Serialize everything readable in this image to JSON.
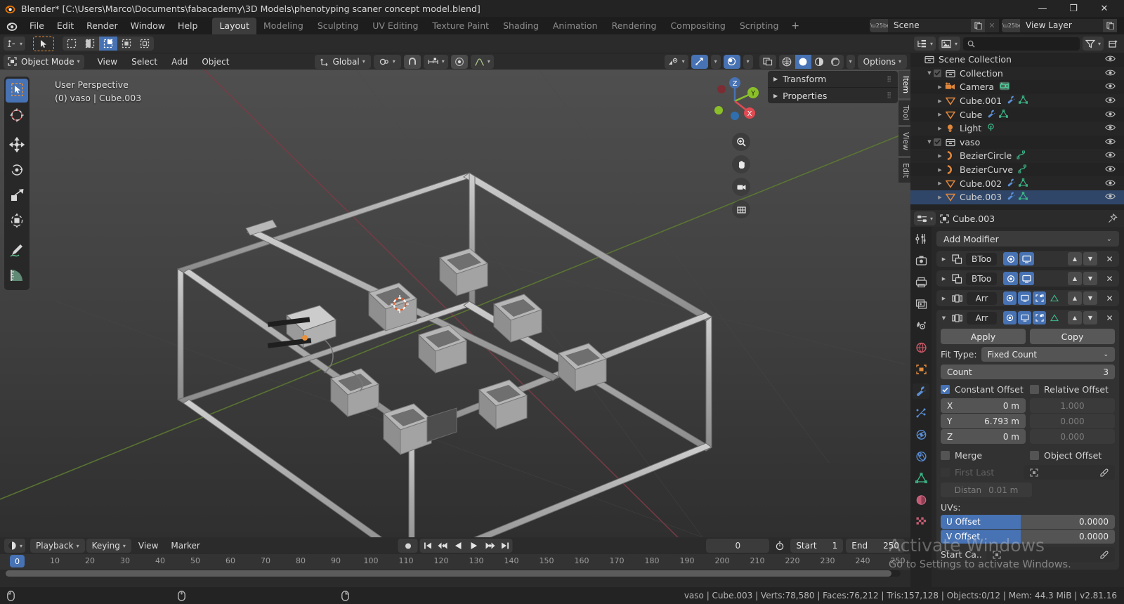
{
  "window": {
    "title": "Blender* [C:\\Users\\Marco\\Documents\\fabacademy\\3D Models\\phenotyping scaner concept model.blend]",
    "minimize": "—",
    "maximize": "❐",
    "close": "✕"
  },
  "menubar": {
    "items": [
      "File",
      "Edit",
      "Render",
      "Window",
      "Help"
    ],
    "workspaces": [
      {
        "label": "Layout",
        "active": true
      },
      {
        "label": "Modeling",
        "active": false
      },
      {
        "label": "Sculpting",
        "active": false
      },
      {
        "label": "UV Editing",
        "active": false
      },
      {
        "label": "Texture Paint",
        "active": false
      },
      {
        "label": "Shading",
        "active": false
      },
      {
        "label": "Animation",
        "active": false
      },
      {
        "label": "Rendering",
        "active": false
      },
      {
        "label": "Compositing",
        "active": false
      },
      {
        "label": "Scripting",
        "active": false
      }
    ],
    "add_workspace": "+",
    "scene": {
      "name": "Scene",
      "new_icon": "copy-icon",
      "delete_icon": "x-icon"
    },
    "view_layer": {
      "name": "View Layer",
      "new_icon": "copy-icon"
    }
  },
  "viewport": {
    "editor_type_icon": "editor-type-icon",
    "select_tools": [
      "tweak",
      "select-box",
      "select-circle",
      "select-lasso"
    ],
    "mode": "Object Mode",
    "menus": [
      "View",
      "Select",
      "Add",
      "Object"
    ],
    "transform_orientation": "Global",
    "snap_magnet": "magnet-icon",
    "proportional_edit": "proportional-icon",
    "overlay_text_line1": "User Perspective",
    "overlay_text_line2": "(0) vaso | Cube.003",
    "options_label": "Options",
    "shading_modes": [
      "wireframe",
      "solid",
      "material-preview",
      "rendered"
    ],
    "active_shading": "solid",
    "gizmo_axes": [
      {
        "label": "Z",
        "color": "#4772b3"
      },
      {
        "label": "Y",
        "color": "#8bbf2a"
      },
      {
        "label": "X",
        "color": "#e04a52"
      }
    ],
    "nav_buttons": [
      "zoom-icon",
      "pan-hand-icon",
      "camera-icon",
      "ortho-persp-icon"
    ],
    "side_panel": [
      {
        "label": "Transform"
      },
      {
        "label": "Properties"
      }
    ],
    "side_tabs": [
      {
        "label": "Item",
        "active": true
      },
      {
        "label": "Tool",
        "active": false
      },
      {
        "label": "View",
        "active": false
      },
      {
        "label": "Edit",
        "active": false
      }
    ],
    "left_tools": [
      {
        "name": "tweak-tool",
        "selected": true
      },
      {
        "name": "cursor-tool",
        "selected": false
      },
      {
        "name": "move-tool",
        "selected": false
      },
      {
        "name": "rotate-tool",
        "selected": false
      },
      {
        "name": "scale-tool",
        "selected": false
      },
      {
        "name": "transform-tool",
        "selected": false
      },
      {
        "name": "annotate-tool",
        "selected": false
      },
      {
        "name": "measure-tool",
        "selected": false
      }
    ]
  },
  "timeline": {
    "editor_icon": "timeline-icon",
    "menus": [
      "Playback",
      "Keying",
      "View",
      "Marker"
    ],
    "transport": [
      "record",
      "jump-start",
      "prev-keyframe",
      "play-reverse",
      "play",
      "next-keyframe",
      "jump-end"
    ],
    "current_frame": "0",
    "start_label": "Start",
    "start_value": "1",
    "end_label": "End",
    "end_value": "250",
    "ticks": [
      "0",
      "10",
      "20",
      "30",
      "40",
      "50",
      "60",
      "70",
      "80",
      "90",
      "100",
      "110",
      "120",
      "130",
      "140",
      "150",
      "160",
      "170",
      "180",
      "190",
      "200",
      "210",
      "220",
      "230",
      "240",
      "250"
    ],
    "playhead_label": "0"
  },
  "outliner": {
    "display_mode_icon": "view-layer-icon",
    "filter_icon": "filter-icon",
    "new_collection_icon": "new-collection-icon",
    "search_placeholder": "",
    "rows": [
      {
        "label": "Scene Collection",
        "indent": 0,
        "icon": "collection-icon",
        "tri": "",
        "checkbox": false,
        "eye": true,
        "selected": false,
        "extras": []
      },
      {
        "label": "Collection",
        "indent": 1,
        "icon": "collection-icon",
        "tri": "▼",
        "checkbox": true,
        "eye": true,
        "selected": false,
        "extras": []
      },
      {
        "label": "Camera",
        "indent": 2,
        "icon": "camera-icon",
        "tri": "▶",
        "checkbox": false,
        "eye": true,
        "selected": false,
        "extras": [
          "camera-data-icon"
        ]
      },
      {
        "label": "Cube.001",
        "indent": 2,
        "icon": "mesh-icon",
        "tri": "▶",
        "checkbox": false,
        "eye": true,
        "selected": false,
        "extras": [
          "wrench-icon",
          "mesh-data-icon"
        ]
      },
      {
        "label": "Cube",
        "indent": 2,
        "icon": "mesh-icon",
        "tri": "▶",
        "checkbox": false,
        "eye": true,
        "selected": false,
        "extras": [
          "wrench-icon",
          "mesh-data-icon"
        ]
      },
      {
        "label": "Light",
        "indent": 2,
        "icon": "light-icon",
        "tri": "▶",
        "checkbox": false,
        "eye": true,
        "selected": false,
        "extras": [
          "light-data-icon"
        ]
      },
      {
        "label": "vaso",
        "indent": 1,
        "icon": "collection-icon",
        "tri": "▼",
        "checkbox": true,
        "eye": true,
        "selected": false,
        "extras": []
      },
      {
        "label": "BezierCircle",
        "indent": 2,
        "icon": "curve-icon",
        "tri": "▶",
        "checkbox": false,
        "eye": true,
        "selected": false,
        "extras": [
          "curve-data-icon"
        ]
      },
      {
        "label": "BezierCurve",
        "indent": 2,
        "icon": "curve-icon",
        "tri": "▶",
        "checkbox": false,
        "eye": true,
        "selected": false,
        "extras": [
          "curve-data-icon"
        ]
      },
      {
        "label": "Cube.002",
        "indent": 2,
        "icon": "mesh-icon",
        "tri": "▶",
        "checkbox": false,
        "eye": true,
        "selected": false,
        "extras": [
          "wrench-icon",
          "mesh-data-icon"
        ]
      },
      {
        "label": "Cube.003",
        "indent": 2,
        "icon": "mesh-icon",
        "tri": "▶",
        "checkbox": false,
        "eye": true,
        "selected": true,
        "extras": [
          "wrench-icon",
          "mesh-data-icon"
        ]
      }
    ]
  },
  "properties": {
    "editor_icon": "properties-icon",
    "object_icon": "object-icon",
    "object_name": "Cube.003",
    "pin_icon": "pin-icon",
    "tabs": [
      {
        "name": "tool-tab",
        "active": false
      },
      {
        "name": "render-tab",
        "active": false
      },
      {
        "name": "output-tab",
        "active": false
      },
      {
        "name": "view-layer-tab",
        "active": false
      },
      {
        "name": "scene-tab",
        "active": false
      },
      {
        "name": "world-tab",
        "active": false
      },
      {
        "name": "object-tab",
        "active": false
      },
      {
        "name": "modifier-tab",
        "active": true
      },
      {
        "name": "particles-tab",
        "active": false
      },
      {
        "name": "physics-tab",
        "active": false
      },
      {
        "name": "constraints-tab",
        "active": false
      },
      {
        "name": "data-tab",
        "active": false
      },
      {
        "name": "material-tab",
        "active": false
      },
      {
        "name": "texture-tab",
        "active": false
      }
    ],
    "add_modifier": "Add Modifier",
    "add_modifier_chevron": "⌄",
    "modifiers": [
      {
        "name": "BToo",
        "type": "boolean",
        "expanded": false,
        "tri": "▶",
        "toggles": [
          {
            "icon": "render-icon",
            "on": true
          },
          {
            "icon": "viewport-icon",
            "on": true
          }
        ]
      },
      {
        "name": "BToo",
        "type": "boolean",
        "expanded": false,
        "tri": "▶",
        "toggles": [
          {
            "icon": "render-icon",
            "on": true
          },
          {
            "icon": "viewport-icon",
            "on": true
          }
        ]
      },
      {
        "name": "Arr",
        "type": "array",
        "expanded": false,
        "tri": "▶",
        "toggles": [
          {
            "icon": "render-icon",
            "on": true
          },
          {
            "icon": "viewport-icon",
            "on": true
          },
          {
            "icon": "edit-mode-icon",
            "on": true
          },
          {
            "icon": "cage-icon",
            "on": false
          }
        ]
      },
      {
        "name": "Arr",
        "type": "array",
        "expanded": true,
        "tri": "▼",
        "toggles": [
          {
            "icon": "render-icon",
            "on": true
          },
          {
            "icon": "viewport-icon",
            "on": true
          },
          {
            "icon": "edit-mode-icon",
            "on": true
          },
          {
            "icon": "cage-icon",
            "on": false
          }
        ]
      }
    ],
    "array_panel": {
      "apply": "Apply",
      "copy": "Copy",
      "fit_type_label": "Fit Type:",
      "fit_type_value": "Fixed Count",
      "count_label": "Count",
      "count_value": "3",
      "constant_offset_label": "Constant Offset",
      "constant_offset_on": true,
      "relative_offset_label": "Relative Offset",
      "relative_offset_on": false,
      "constant_values": [
        {
          "axis": "X",
          "value": "0 m"
        },
        {
          "axis": "Y",
          "value": "6.793 m"
        },
        {
          "axis": "Z",
          "value": "0 m"
        }
      ],
      "relative_values": [
        "1.000",
        "0.000",
        "0.000"
      ],
      "merge_label": "Merge",
      "merge_on": false,
      "object_offset_label": "Object Offset",
      "object_offset_on": false,
      "first_last_label": "First Last",
      "first_last_on": false,
      "object_offset_value": "",
      "eyedropper_icon": "eyedropper-icon",
      "distance_label": "Distan",
      "distance_value": "0.01 m",
      "uvs_label": "UVs:",
      "u_offset_label": "U Offset",
      "u_offset_value": "0.0000",
      "v_offset_label": "V Offset",
      "v_offset_value": "0.0000",
      "start_cap_label": "Start Ca.."
    }
  },
  "watermark": {
    "line1": "Activate Windows",
    "line2": "Go to Settings to activate Windows."
  },
  "statusbar": {
    "mouse_hints": [
      "select",
      "",
      ""
    ],
    "stats": "vaso | Cube.003 | Verts:78,580 | Faces:76,212 | Tris:157,128 | Objects:0/12 | Mem: 44.3 MiB | v2.81.16"
  },
  "colors": {
    "accent_blue": "#4772b3",
    "orange": "#e8913a",
    "axis_x": "#e04a52",
    "axis_y": "#8bbf2a",
    "axis_z": "#4772b3",
    "panel_bg": "#282828",
    "header_bg": "#2b2b2b"
  }
}
